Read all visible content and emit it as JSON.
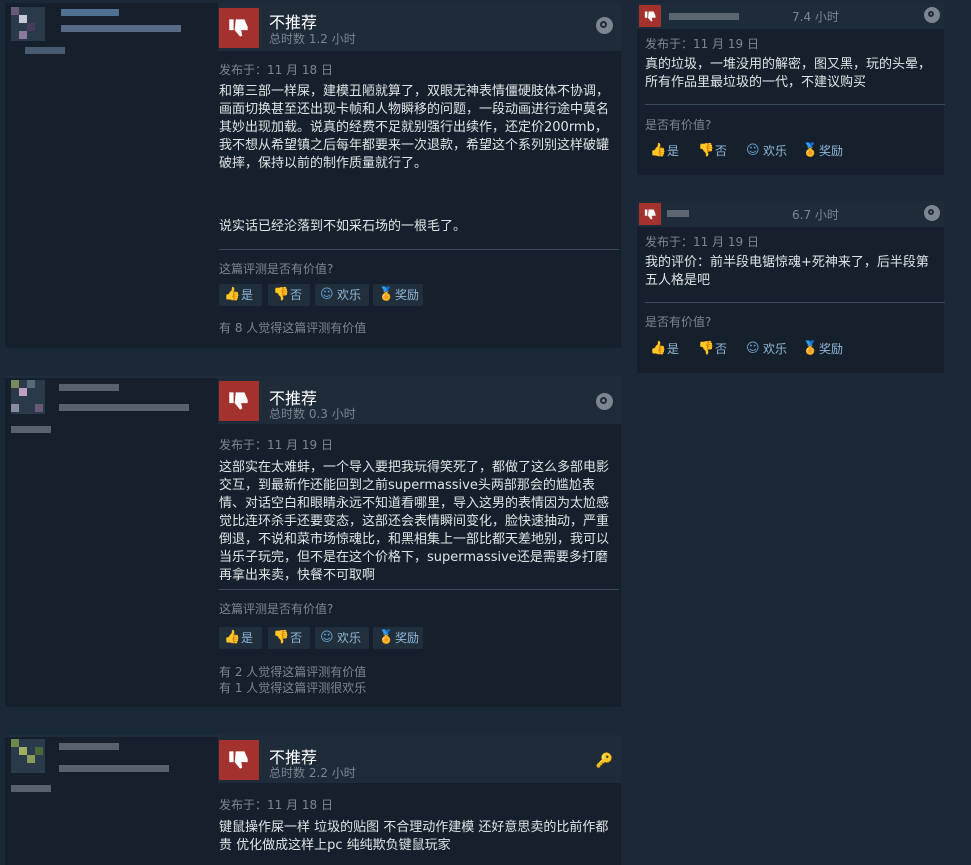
{
  "reviews": [
    {
      "verdict": "不推荐",
      "hours": "总时数 1.2 小时",
      "posted": "发布于：11 月 18 日",
      "body_1": "和第三部一样屎，建模丑陋就算了，双眼无神表情僵硬肢体不协调，画面切换甚至还出现卡帧和人物瞬移的问题，一段动画进行途中莫名其妙出现加载。说真的经费不足就别强行出续作，还定价200rmb，我不想从希望镇之后每年都要来一次退款，希望这个系列别这样破罐破摔，保持以前的制作质量就行了。",
      "body_2": "说实话已经沦落到不如采石场的一根毛了。",
      "helpful_question": "这篇评测是否有价值?",
      "found": [
        "有 8 人觉得这篇评测有价值"
      ]
    },
    {
      "verdict": "不推荐",
      "hours": "总时数 0.3 小时",
      "posted": "发布于：11 月 19 日",
      "body_1": "这部实在太难蚌，一个导入要把我玩得笑死了，都做了这么多部电影交互，到最新作还能回到之前supermassive头两部那会的尴尬表情、对话空白和眼睛永远不知道看哪里，导入这男的表情因为太尬感觉比连环杀手还要变态，这部还会表情瞬间变化，脸快速抽动，严重倒退，不说和菜市场惊魂比，和黑相集上一部比都天差地别，我可以当乐子玩完，但不是在这个价格下，supermassive还是需要多打磨再拿出来卖，快餐不可取啊",
      "helpful_question": "这篇评测是否有价值?",
      "found": [
        "有 2 人觉得这篇评测有价值",
        "有 1 人觉得这篇评测很欢乐"
      ]
    },
    {
      "verdict": "不推荐",
      "hours": "总时数 2.2 小时",
      "posted": "发布于：11 月 18 日",
      "body_1": "键鼠操作屎一样 垃圾的贴图 不合理动作建模 还好意思卖的比前作都贵 优化做成这样上pc 纯纯欺负键鼠玩家"
    }
  ],
  "side_reviews": [
    {
      "hours": "7.4 小时",
      "posted": "发布于：11 月 19 日",
      "body": "真的垃圾，一堆没用的解密，图又黑，玩的头晕，所有作品里最垃圾的一代，不建议购买",
      "helpful_question": "是否有价值?"
    },
    {
      "hours": "6.7 小时",
      "posted": "发布于：11 月 19 日",
      "body": "我的评价：前半段电锯惊魂+死神来了，后半段第五人格是吧",
      "helpful_question": "是否有价值?"
    }
  ],
  "buttons": {
    "yes": "是",
    "no": "否",
    "funny": "欢乐",
    "award": "奖励"
  },
  "colors": {
    "background": "#1b2838",
    "thumb_down": "#a3312e",
    "button_text": "#8fb7d6",
    "award": "#e3b341"
  },
  "icons": {
    "verdict": "thumbs-down-icon",
    "platform": "steam-icon",
    "key": "key-icon"
  }
}
